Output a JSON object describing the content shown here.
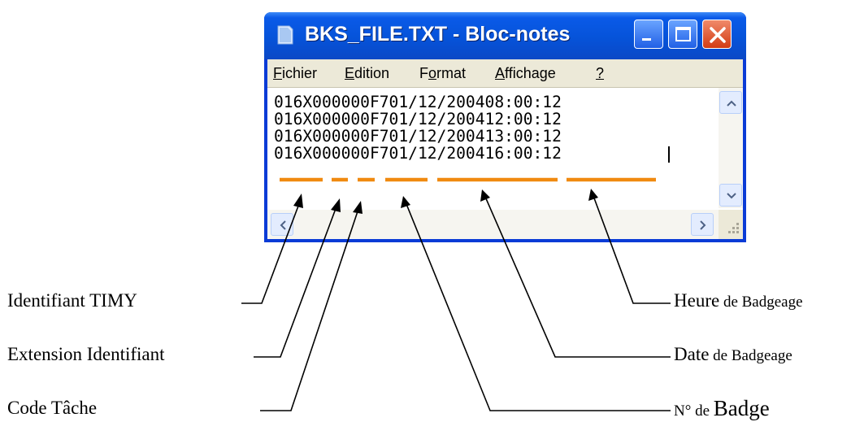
{
  "window": {
    "title": "BKS_FILE.TXT - Bloc-notes",
    "menu": [
      {
        "mnemonic": "F",
        "rest": "ichier"
      },
      {
        "mnemonic": "E",
        "rest": "dition"
      },
      {
        "pre": "F",
        "mnemonic": "o",
        "rest": "rmat"
      },
      {
        "mnemonic": "A",
        "rest": "ffichage"
      },
      {
        "mnemonic": "?",
        "rest": ""
      }
    ],
    "lines": [
      "016X000000F701/12/200408:00:12",
      "016X000000F701/12/200412:00:12",
      "016X000000F701/12/200413:00:12",
      "016X000000F701/12/200416:00:12"
    ]
  },
  "annotations": {
    "identifiant_timy": "Identifiant TIMY",
    "extension_identifiant": "Extension Identifiant",
    "code_tache": "Code Tâche",
    "heure_main": "Heure",
    "heure_rest": " de Badgeage",
    "date_main": "Date",
    "date_rest": " de Badgeage",
    "badge_pre": "N° de ",
    "badge_main": "Badge"
  },
  "colors": {
    "underline": "#f08a10",
    "titlebar": "#0653d9",
    "menubar": "#ece9d8"
  }
}
